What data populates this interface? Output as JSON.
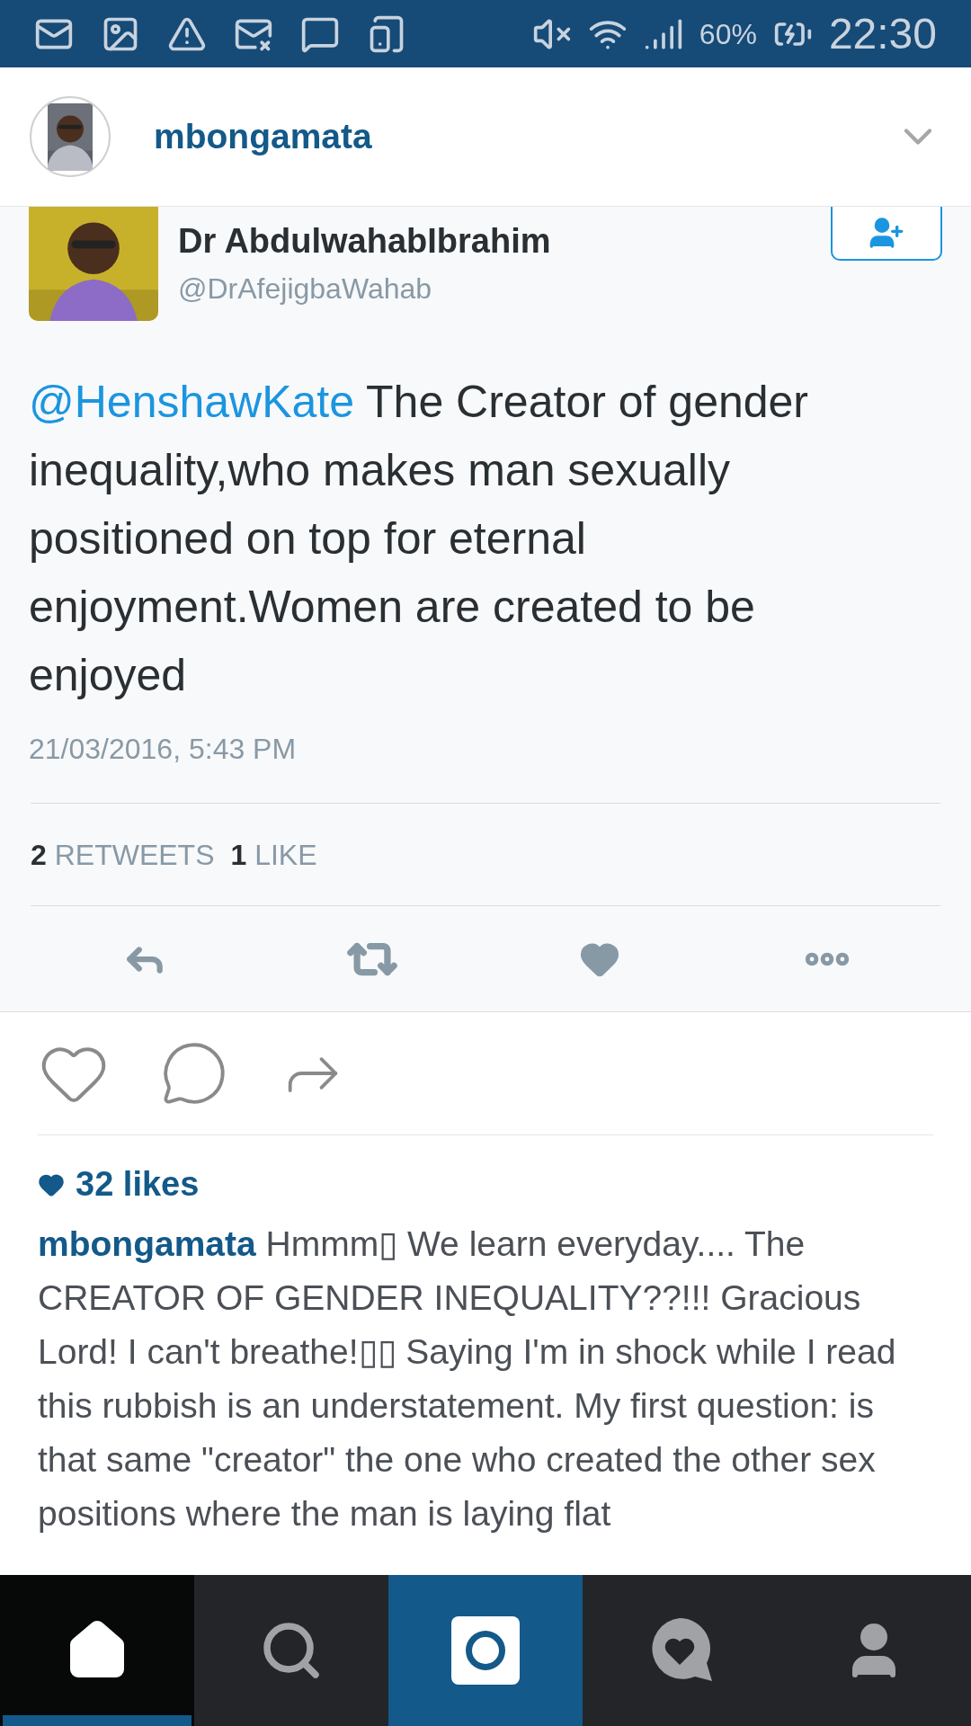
{
  "status_bar": {
    "battery": "60%",
    "time": "22:30"
  },
  "header": {
    "username": "mbongamata"
  },
  "tweet": {
    "name": "Dr AbdulwahabIbrahim",
    "handle": "@DrAfejigbaWahab",
    "mention": "@HenshawKate",
    "text": "The Creator of gender inequality,who makes man sexually positioned on top for eternal enjoyment.Women are created to be enjoyed",
    "date": "21/03/2016, 5:43 PM",
    "retweets_count": "2",
    "retweets_label": "RETWEETS",
    "likes_count": "1",
    "likes_label": "LIKE"
  },
  "post": {
    "likes": "32 likes",
    "caption_user": "mbongamata",
    "caption": "Hmmm▯ We learn everyday.... The CREATOR OF GENDER INEQUALITY??!!! Gracious Lord! I can't breathe!▯▯ Saying I'm in shock while I read this rubbish is an understatement. My first question: is that same \"creator\" the one who created the other sex positions where the man is laying flat"
  },
  "nav": [
    {
      "kind": "home",
      "selected": true
    },
    {
      "kind": "search",
      "selected": false
    },
    {
      "kind": "camera",
      "selected": false
    },
    {
      "kind": "activity",
      "selected": false
    },
    {
      "kind": "profile",
      "selected": false
    }
  ]
}
